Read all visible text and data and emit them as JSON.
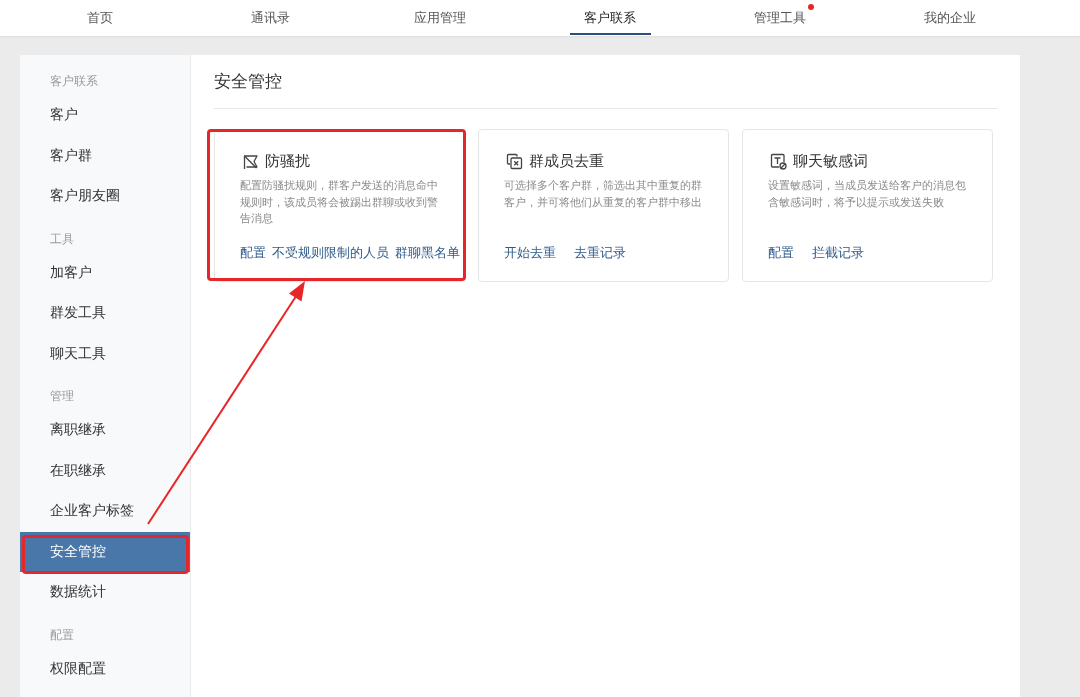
{
  "nav": [
    {
      "label": "首页",
      "selected": false,
      "dot": false
    },
    {
      "label": "通讯录",
      "selected": false,
      "dot": false
    },
    {
      "label": "应用管理",
      "selected": false,
      "dot": false
    },
    {
      "label": "客户联系",
      "selected": true,
      "dot": false
    },
    {
      "label": "管理工具",
      "selected": false,
      "dot": true
    },
    {
      "label": "我的企业",
      "selected": false,
      "dot": false
    }
  ],
  "sidebar": {
    "groups": [
      {
        "title": "客户联系",
        "items": [
          {
            "label": "客户",
            "selected": false,
            "highlighted": false
          },
          {
            "label": "客户群",
            "selected": false,
            "highlighted": false
          },
          {
            "label": "客户朋友圈",
            "selected": false,
            "highlighted": false
          }
        ]
      },
      {
        "title": "工具",
        "items": [
          {
            "label": "加客户",
            "selected": false,
            "highlighted": false
          },
          {
            "label": "群发工具",
            "selected": false,
            "highlighted": false
          },
          {
            "label": "聊天工具",
            "selected": false,
            "highlighted": false
          }
        ]
      },
      {
        "title": "管理",
        "items": [
          {
            "label": "离职继承",
            "selected": false,
            "highlighted": false
          },
          {
            "label": "在职继承",
            "selected": false,
            "highlighted": false
          },
          {
            "label": "企业客户标签",
            "selected": false,
            "highlighted": false
          },
          {
            "label": "安全管控",
            "selected": true,
            "highlighted": true
          },
          {
            "label": "数据统计",
            "selected": false,
            "highlighted": false
          }
        ]
      },
      {
        "title": "配置",
        "items": [
          {
            "label": "权限配置",
            "selected": false,
            "highlighted": false
          }
        ]
      }
    ]
  },
  "content": {
    "title": "安全管控",
    "cards": [
      {
        "title": "防骚扰",
        "description": "配置防骚扰规则，群客户发送的消息命中规则时，该成员将会被踢出群聊或收到警告消息",
        "links": [
          "配置",
          "不受规则限制的人员",
          "群聊黑名单"
        ],
        "highlighted": true
      },
      {
        "title": "群成员去重",
        "description": "可选择多个客户群，筛选出其中重复的群客户，并可将他们从重复的客户群中移出",
        "links": [
          "开始去重",
          "去重记录"
        ],
        "highlighted": false
      },
      {
        "title": "聊天敏感词",
        "description": "设置敏感词，当成员发送给客户的消息包含敏感词时，将予以提示或发送失败",
        "links": [
          "配置",
          "拦截记录"
        ],
        "highlighted": false
      }
    ]
  }
}
